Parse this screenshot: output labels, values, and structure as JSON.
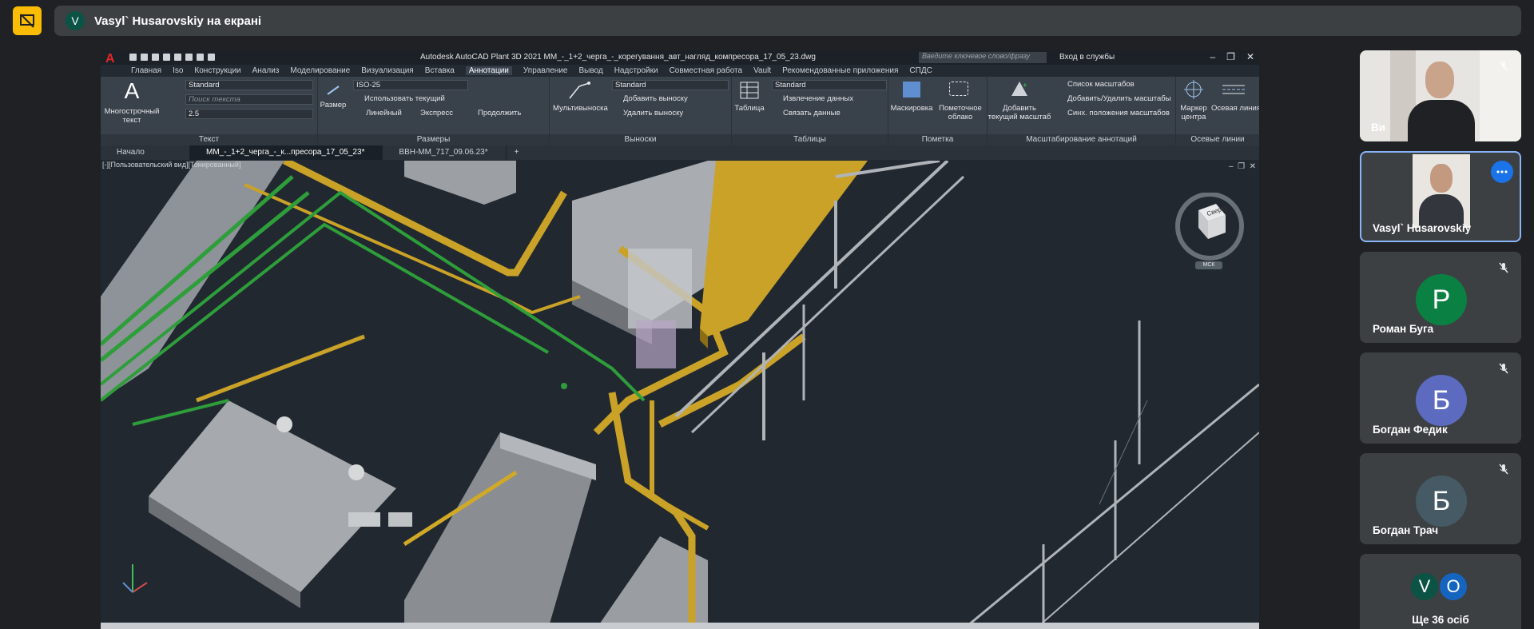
{
  "meeting": {
    "presenting_banner": "Vasyl` Husarovskiy на екрані",
    "presenter_initial": "V"
  },
  "acad": {
    "logo_letter": "A",
    "title": "Autodesk AutoCAD Plant 3D 2021    ММ_-_1+2_черга_-_корегування_авт_нагляд_компресора_17_05_23.dwg",
    "search_placeholder": "Введите ключевое слово/фразу",
    "login": "Вход в службы",
    "menu_tabs": [
      "Главная",
      "Iso",
      "Конструкции",
      "Анализ",
      "Моделирование",
      "Визуализация",
      "Вставка",
      "Аннотации",
      "Управление",
      "Вывод",
      "Надстройки",
      "Совместная работа",
      "Vault",
      "Рекомендованные приложения",
      "СПДС"
    ],
    "active_tab": "Аннотации",
    "ribbon": {
      "text_panel": {
        "big_button": "Многострочный текст",
        "style": "Standard",
        "find_placeholder": "Поиск текста",
        "height": "2.5",
        "label": "Текст"
      },
      "dims_panel": {
        "big_button": "Размер",
        "style": "ISO-25",
        "use_current": "Использовать текущий",
        "linear": "Линейный",
        "express": "Экспресс",
        "continue": "Продолжить",
        "label": "Размеры"
      },
      "leaders_panel": {
        "big_button": "Мультивыноска",
        "style": "Standard",
        "add": "Добавить выноску",
        "remove": "Удалить выноску",
        "label": "Выноски"
      },
      "tables_panel": {
        "big_button": "Таблица",
        "style": "Standard",
        "extract": "Извлечение данных",
        "link": "Связать данные",
        "label": "Таблицы"
      },
      "markup_panel": {
        "wipeout": "Маскировка",
        "revcloud": "Пометочное облако",
        "label": "Пометка"
      },
      "scale_panel": {
        "add_scale": "Добавить текущий масштаб",
        "scale_list": "Список масштабов",
        "add_remove": "Добавить/Удалить масштабы",
        "sync": "Синх. положения масштабов",
        "label": "Масштабирование аннотаций"
      },
      "centerline_panel": {
        "center_mark": "Маркер центра",
        "centerline": "Осевая линия",
        "label": "Осевые линии"
      }
    },
    "doc_tabs": [
      "Начало",
      "ММ_-_1+2_черга_-_к...пресора_17_05_23*",
      "ВВН-ММ_717_09.06.23*"
    ],
    "viewport_label": "[-][Пользовательский вид][Тонированный]",
    "viewcube": {
      "face": "Сверху",
      "ucs": "МСК"
    }
  },
  "participants": [
    {
      "name": "Ви",
      "type": "video",
      "muted": true
    },
    {
      "name": "Vasyl` Husarovskiy",
      "type": "video",
      "muted": false
    },
    {
      "name": "Роман Буга",
      "initial": "Р",
      "color": "#0b8043",
      "muted": true
    },
    {
      "name": "Богдан Федик",
      "initial": "Б",
      "color": "#5c6bc0",
      "muted": true
    },
    {
      "name": "Богдан Трач",
      "initial": "Б",
      "color": "#455a64",
      "muted": true
    },
    {
      "name": "Ще 36 осіб",
      "initials": [
        "V",
        "O"
      ],
      "colors": [
        "#0b5345",
        "#1565c0"
      ]
    }
  ],
  "colors": {
    "accent": "#1a73e8",
    "present_icon": "#fbbc04",
    "pipe_yellow": "#c9a227",
    "pipe_green": "#2e9e3a"
  }
}
